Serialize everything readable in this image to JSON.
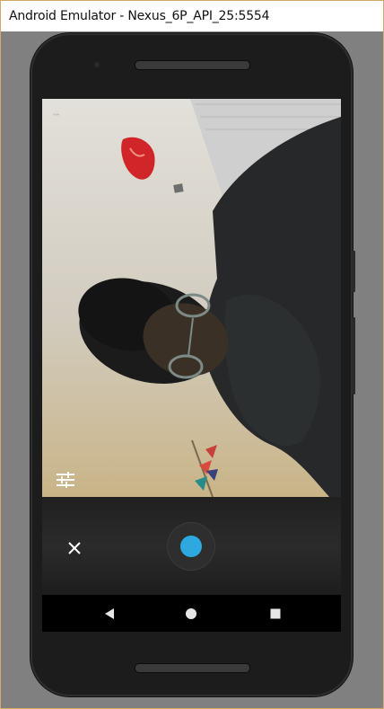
{
  "window": {
    "title": "Android Emulator - Nexus_6P_API_25:5554"
  },
  "viewfinder": {
    "hud_text": "•••"
  },
  "camera": {
    "settings_icon": "sliders-icon",
    "close_icon": "close-icon",
    "shutter_color": "#2da9e0"
  },
  "navbar": {
    "back_icon": "back-triangle-icon",
    "home_icon": "home-circle-icon",
    "recents_icon": "recents-square-icon"
  },
  "colors": {
    "frame_border": "#d9a86c",
    "phone_body": "#1c1c1c",
    "accent": "#2da9e0"
  }
}
